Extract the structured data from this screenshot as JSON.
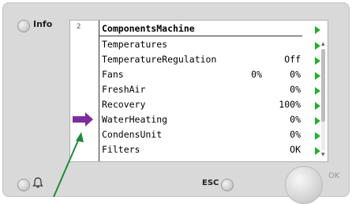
{
  "device": {
    "info_label": "Info",
    "esc_label": "ESC",
    "ok_label": "OK",
    "bell_icon": "bell-icon"
  },
  "screen": {
    "page_number": "2",
    "title": "ComponentsMachine",
    "rows": [
      {
        "name": "Temperatures",
        "value1": "",
        "value2": ""
      },
      {
        "name": "TemperatureRegulation",
        "value1": "",
        "value2": "Off"
      },
      {
        "name": "Fans",
        "value1": "0%",
        "value2": "0%"
      },
      {
        "name": "FreshAir",
        "value1": "",
        "value2": "0%"
      },
      {
        "name": "Recovery",
        "value1": "",
        "value2": "100%"
      },
      {
        "name": "WaterHeating",
        "value1": "",
        "value2": "0%"
      },
      {
        "name": "CondensUnit",
        "value1": "",
        "value2": "0%"
      },
      {
        "name": "Filters",
        "value1": "",
        "value2": "OK"
      }
    ]
  },
  "annotations": {
    "purple_arrow_target": "WaterHeating",
    "purple_color": "#7b2c9e",
    "green_color": "#1f8a3a",
    "accent_green": "#23b02a"
  }
}
